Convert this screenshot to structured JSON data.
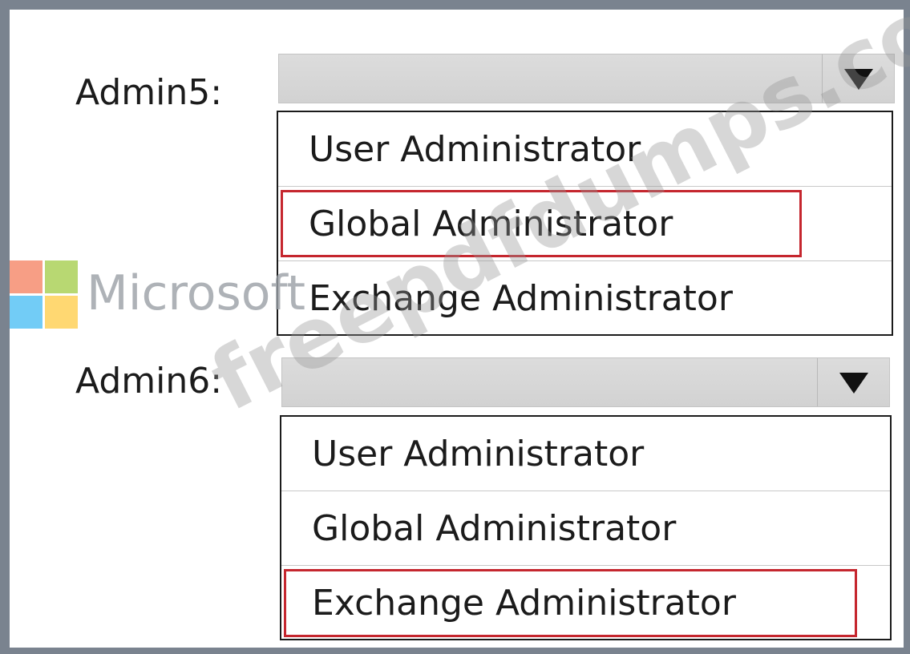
{
  "admin5": {
    "label": "Admin5:",
    "selected_value": "",
    "options": [
      {
        "label": "User Administrator",
        "selected": false
      },
      {
        "label": "Global Administrator",
        "selected": true
      },
      {
        "label": "Exchange Administrator",
        "selected": false
      }
    ]
  },
  "admin6": {
    "label": "Admin6:",
    "selected_value": "",
    "options": [
      {
        "label": "User Administrator",
        "selected": false
      },
      {
        "label": "Global Administrator",
        "selected": false
      },
      {
        "label": "Exchange Administrator",
        "selected": true
      }
    ]
  },
  "watermark": {
    "logo_text": "Microsoft",
    "overlay_text": "freepdfdumps.com",
    "logo_colors": [
      "#f25022",
      "#7fba00",
      "#00a4ef",
      "#ffb900"
    ]
  },
  "icons": {
    "dropdown_arrow": "chevron-down-icon"
  }
}
